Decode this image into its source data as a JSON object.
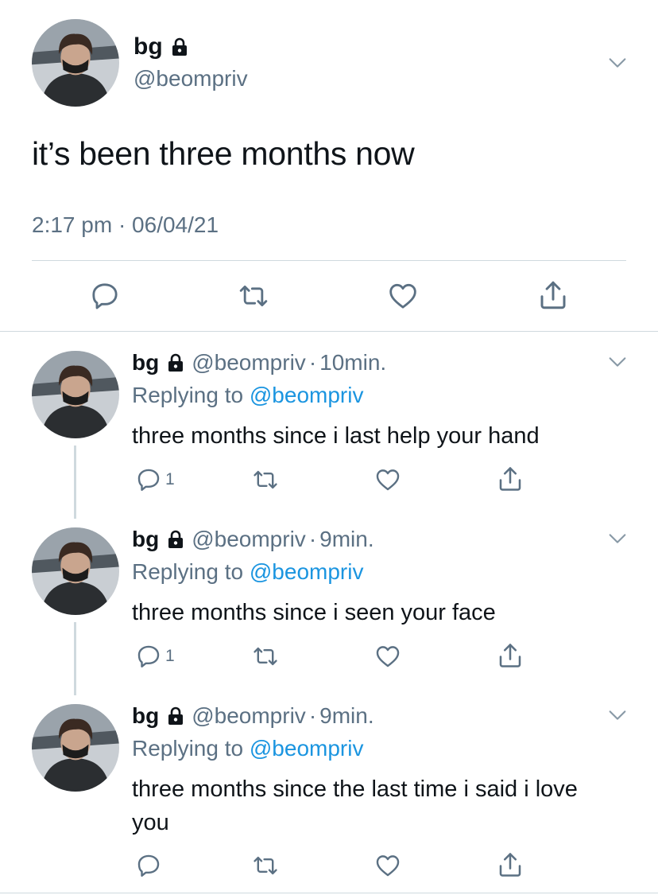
{
  "main_tweet": {
    "display_name": "bg",
    "handle": "@beompriv",
    "text": "it’s been three months now",
    "timestamp": "2:17 pm · 06/04/21"
  },
  "replies": [
    {
      "display_name": "bg",
      "handle": "@beompriv",
      "dot": "·",
      "time": "10min.",
      "replying_prefix": "Replying to",
      "replying_handle": "@beompriv",
      "text": "three months since i last help your hand",
      "reply_count": "1"
    },
    {
      "display_name": "bg",
      "handle": "@beompriv",
      "dot": "·",
      "time": "9min.",
      "replying_prefix": "Replying to",
      "replying_handle": "@beompriv",
      "text": "three months since i seen your face",
      "reply_count": "1"
    },
    {
      "display_name": "bg",
      "handle": "@beompriv",
      "dot": "·",
      "time": "9min.",
      "replying_prefix": "Replying to",
      "replying_handle": "@beompriv",
      "text": "three months since the last time i said i love you",
      "reply_count": ""
    }
  ],
  "icons": {
    "lock": "lock-icon",
    "chevron": "chevron-down-icon",
    "reply": "reply-icon",
    "retweet": "retweet-icon",
    "like": "heart-icon",
    "share": "share-icon"
  },
  "colors": {
    "link": "#1b95e0",
    "secondary": "#5b7083",
    "divider": "#cfd9de"
  }
}
